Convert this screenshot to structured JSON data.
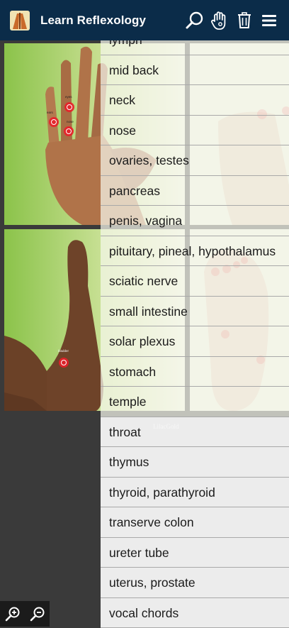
{
  "header": {
    "title": "Learn Reflexology",
    "logo_icon": "reflexology-app-icon",
    "actions": [
      {
        "name": "search",
        "icon": "magnifier-icon"
      },
      {
        "name": "hand-mode",
        "icon": "hand-touch-icon"
      },
      {
        "name": "clear",
        "icon": "trash-icon"
      },
      {
        "name": "menu",
        "icon": "hamburger-menu-icon"
      }
    ],
    "bar_color": "#0b2c49"
  },
  "list": {
    "items": [
      "lymph",
      "mid back",
      "neck",
      "nose",
      "ovaries, testes",
      "pancreas",
      "penis, vagina",
      "pituitary, pineal, hypothalamus",
      "sciatic nerve",
      "small intestine",
      "solar plexus",
      "stomach",
      "temple",
      "throat",
      "thymus",
      "thyroid, parathyroid",
      "transerve colon",
      "ureter tube",
      "uterus, prostate",
      "vocal chords"
    ]
  },
  "images": {
    "hand_front": {
      "point_labels": [
        "eyes",
        "ears",
        "nose"
      ]
    },
    "foot_side": {
      "point_labels": [
        "bladder"
      ]
    }
  },
  "watermark": "LilacGold",
  "zoom": {
    "in_icon": "zoom-in-icon",
    "out_icon": "zoom-out-icon"
  },
  "colors": {
    "point_red": "#e8202a",
    "list_solid_bg": "#ececec",
    "divider": "#a9a9a9"
  }
}
